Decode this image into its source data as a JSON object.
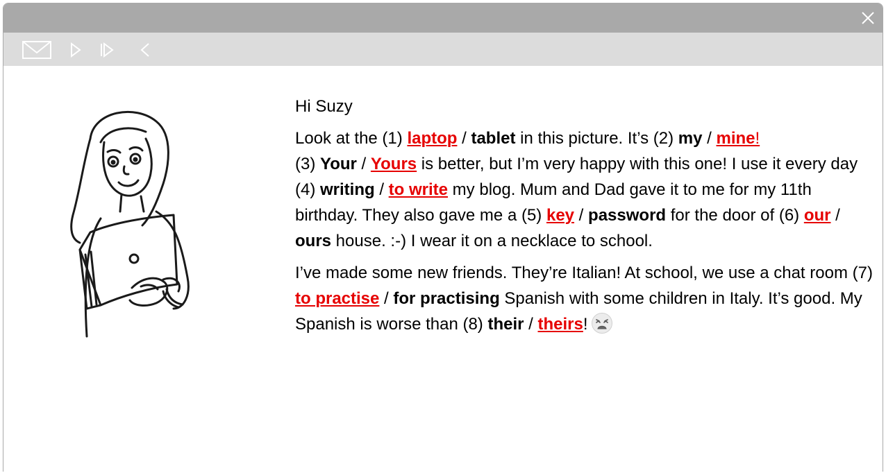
{
  "window": {
    "close_icon": "close-icon",
    "toolbar_icons": [
      "envelope-icon",
      "play-icon",
      "next-icon",
      "back-icon"
    ]
  },
  "email": {
    "greeting": "Hi Suzy",
    "p1": {
      "t1": "Look at the (1) ",
      "q1_correct": "laptop",
      "q1_sep": " / ",
      "q1_other": "tablet",
      "t2": " in this picture. It’s (2) ",
      "q2_other": "my",
      "q2_sep": " / ",
      "q2_correct": "mine",
      "q2_after": "!"
    },
    "p2": {
      "t1": "(3) ",
      "q3_other": "Your",
      "q3_sep": " / ",
      "q3_correct": "Yours",
      "t2": " is better, but I’m very happy with this one! I use it every day (4) ",
      "q4_other": "writing",
      "q4_sep": " / ",
      "q4_correct": "to write",
      "t3": " my blog. Mum and Dad gave it to me for my 11th birthday. They also gave me a (5) ",
      "q5_correct": "key",
      "q5_sep": " / ",
      "q5_other": "password",
      "t4": " for the door of (6) ",
      "q6_correct": "our",
      "q6_sep": " / ",
      "q6_other": "ours",
      "t5": " house. :-) I wear it on a necklace to school."
    },
    "p3": {
      "t1": "I’ve made some new friends. They’re Italian! At school, we use a chat room (7) ",
      "q7_correct": "to practise",
      "q7_sep": " / ",
      "q7_other": "for practising",
      "t2": " Spanish with some children in Italy. It’s good. My Spanish is worse than (8) ",
      "q8_other": "their",
      "q8_sep": " / ",
      "q8_correct": "theirs",
      "t3": "!",
      "emoji": "weary-face-emoji"
    }
  },
  "colors": {
    "titlebar": "#a9a9a9",
    "toolbar": "#dcdcdc",
    "answer": "#e60000"
  }
}
